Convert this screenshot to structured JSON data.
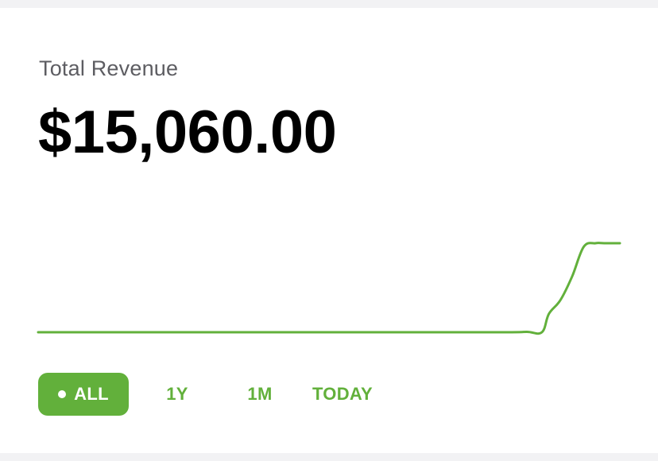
{
  "revenue": {
    "title": "Total Revenue",
    "amount": "$15,060.00"
  },
  "range_tabs": [
    {
      "label": "ALL",
      "selected": true
    },
    {
      "label": "1Y",
      "selected": false
    },
    {
      "label": "1M",
      "selected": false
    },
    {
      "label": "TODAY",
      "selected": false
    }
  ],
  "colors": {
    "accent": "#62b03b",
    "title_text": "#5d5d62",
    "amount_text": "#000000",
    "background": "#f2f2f4",
    "card": "#ffffff"
  },
  "chart_data": {
    "type": "line",
    "x": [
      0,
      0.2,
      0.4,
      0.6,
      0.8,
      0.84,
      0.866,
      0.878,
      0.898,
      0.918,
      0.938,
      0.958,
      0.973,
      1
    ],
    "values": [
      0,
      0,
      0,
      0,
      0,
      0.005,
      0,
      0.21,
      0.37,
      0.64,
      0.98,
      1.02,
      1.02,
      1.02
    ],
    "ylim": [
      0,
      1.05
    ],
    "grid": false,
    "axes_visible": false
  }
}
